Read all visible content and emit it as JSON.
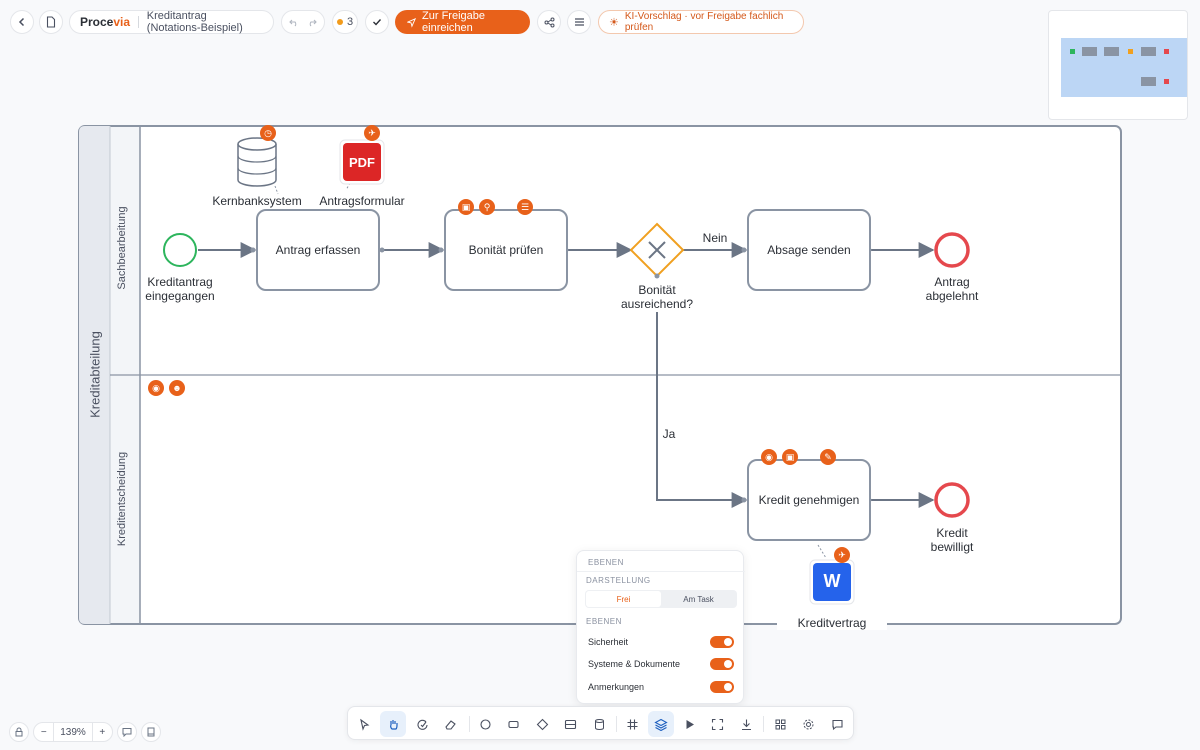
{
  "app": {
    "brand_main": "Proce",
    "brand_accent": "via",
    "document_title": "Kreditantrag (Notations-Beispiel)",
    "comment_count": "3",
    "submit_label": "Zur Freigabe einreichen",
    "ai_hint": "KI-Vorschlag · vor Freigabe fachlich prüfen"
  },
  "colors": {
    "accent": "#e8611a",
    "start_event": "#2db55d",
    "end_event": "#e5484d",
    "gateway": "#f0a020",
    "task_border": "#8a94a3"
  },
  "diagram": {
    "pool_label": "Kreditabteilung",
    "lanes": [
      "Sachbearbeitung",
      "Kreditentscheidung"
    ],
    "start_event": {
      "line1": "Kreditantrag",
      "line2": "eingegangen"
    },
    "tasks": {
      "antrag_erfassen": "Antrag erfassen",
      "bonitaet_pruefen": "Bonität prüfen",
      "absage_senden": "Absage senden",
      "kredit_genehmigen": "Kredit genehmigen"
    },
    "gateway": {
      "line1": "Bonität",
      "line2": "ausreichend?"
    },
    "flow_labels": {
      "no": "Nein",
      "yes": "Ja"
    },
    "end_events": {
      "rejected": {
        "line1": "Antrag",
        "line2": "abgelehnt"
      },
      "approved": {
        "line1": "Kredit",
        "line2": "bewilligt"
      }
    },
    "artifacts": {
      "database": "Kernbanksystem",
      "pdf_form": "Antragsformular",
      "pdf_text": "PDF",
      "word_doc": "Kreditvertrag",
      "word_text": "W"
    }
  },
  "layers_panel": {
    "title": "Ebenen",
    "display_heading": "Darstellung",
    "mode_free": "Frei",
    "mode_task": "Am Task",
    "layers_heading": "Ebenen",
    "layers": [
      {
        "label": "Sicherheit",
        "enabled": true
      },
      {
        "label": "Systeme & Dokumente",
        "enabled": true
      },
      {
        "label": "Anmerkungen",
        "enabled": true
      }
    ]
  },
  "zoom": {
    "minus": "−",
    "value": "139%",
    "plus": "+"
  }
}
